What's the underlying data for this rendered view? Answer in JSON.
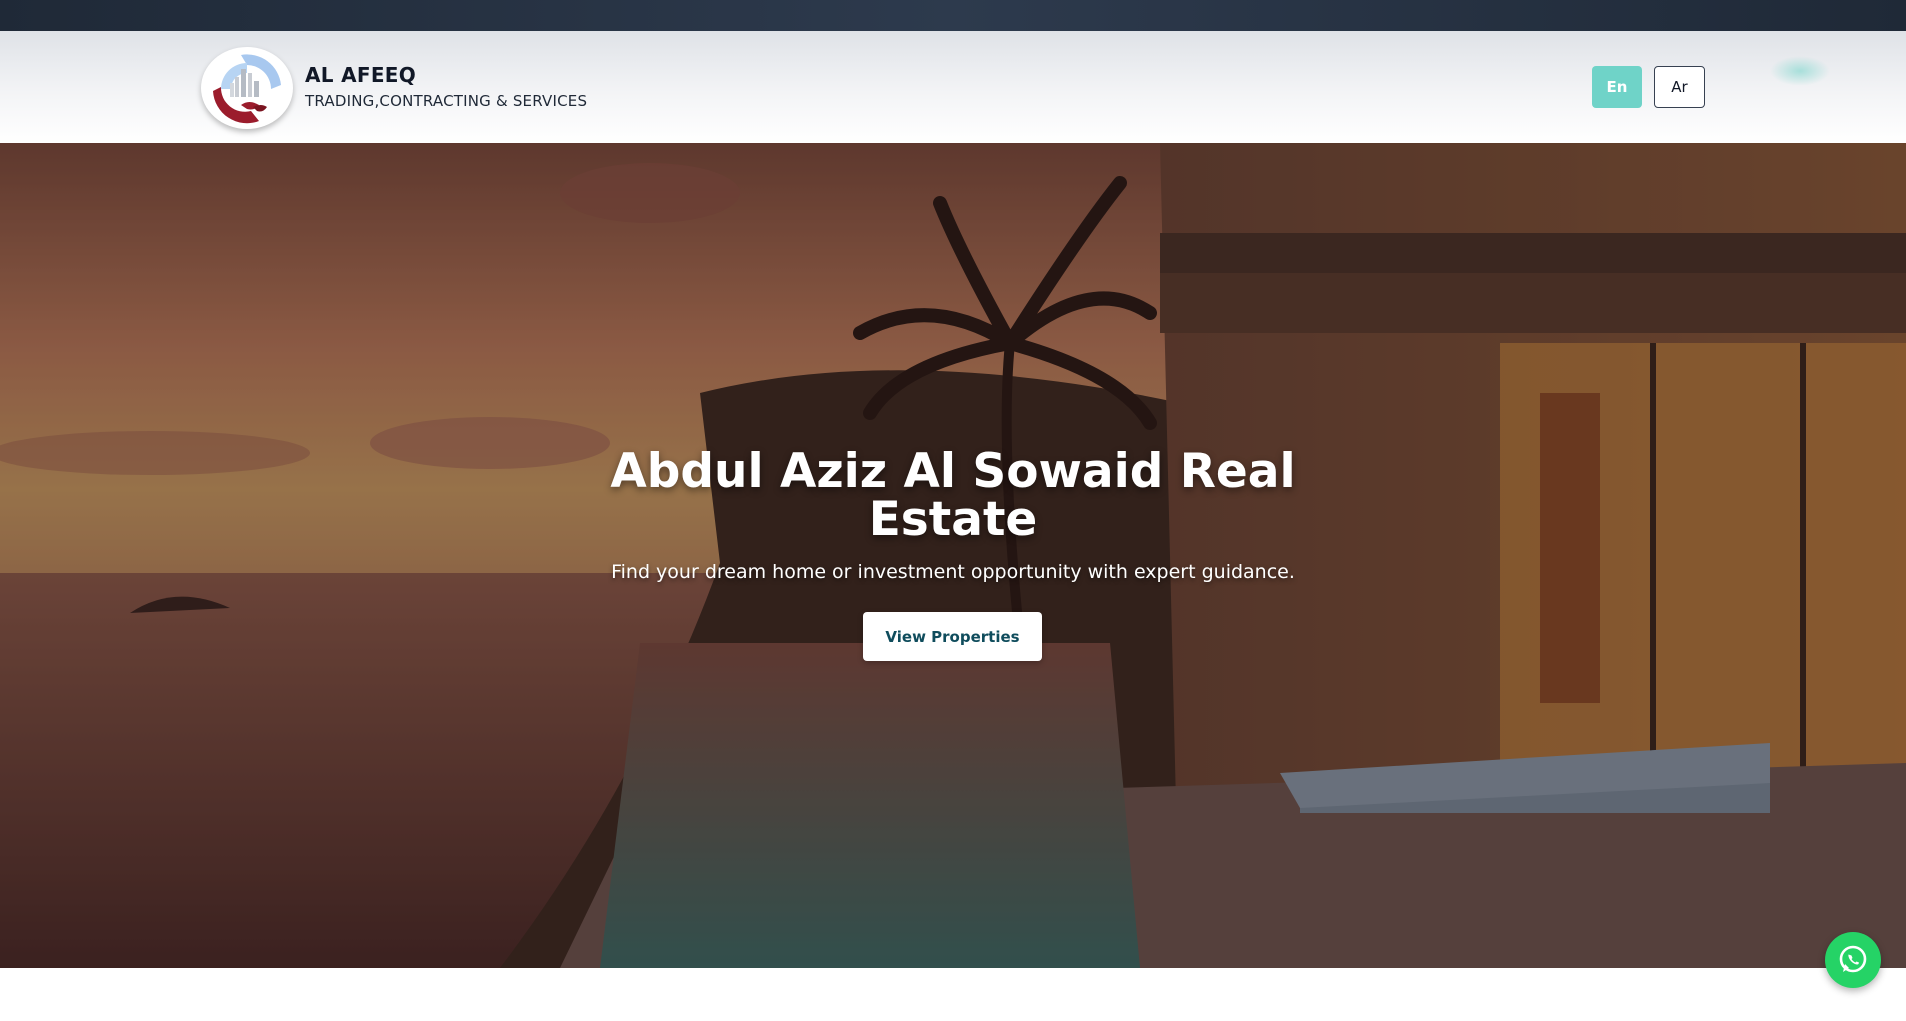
{
  "brand": {
    "name": "AL AFEEQ",
    "tagline": "TRADING,CONTRACTING & SERVICES"
  },
  "language": {
    "en_label": "En",
    "ar_label": "Ar",
    "active": "En"
  },
  "hero": {
    "title": "Abdul Aziz Al Sowaid Real Estate",
    "subtitle": "Find your dream home or investment opportunity with expert guidance.",
    "cta_label": "View Properties"
  },
  "colors": {
    "topbar": "#1f2937",
    "accent_teal": "#6fd3c8",
    "cta_text": "#0f4c5c",
    "whatsapp": "#25d366"
  },
  "icons": {
    "logo": "city-skyline-handshake-logo",
    "whatsapp": "whatsapp-icon"
  }
}
